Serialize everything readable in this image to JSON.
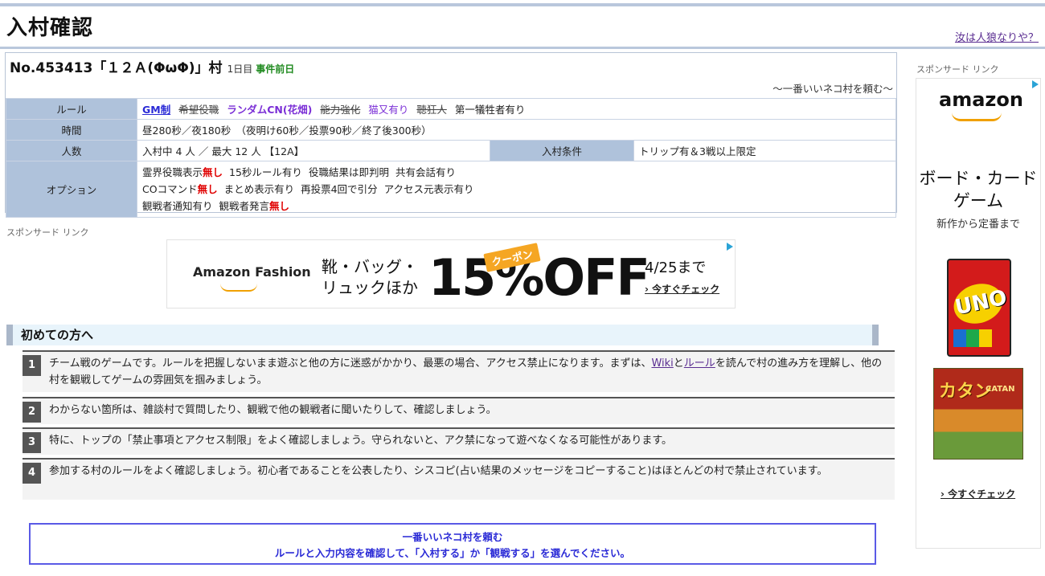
{
  "page": {
    "title": "入村確認",
    "top_link": "汝は人狼なりや？"
  },
  "village": {
    "number_title": "No.453413「１２Ａ(ΦωΦ)」村",
    "day": "1日目",
    "phase": "事件前日",
    "slogan": "～一番いいネコ村を頼む～"
  },
  "info": {
    "rule_label": "ルール",
    "rules": {
      "gm": "GM制",
      "kibou": "希望役職",
      "random": "ランダムCN(花畑)",
      "nouryoku": "能力強化",
      "nekomata": "猫又有り",
      "kyoujin": "聴狂人",
      "gisei": "第一犠牲者有り"
    },
    "time_label": "時間",
    "time_value": "昼280秒／夜180秒　（夜明け60秒／投票90秒／終了後300秒）",
    "ninzu_label": "人数",
    "ninzu_value": "入村中 4 人 ／ 最大 12 人 【12A】",
    "cond_label": "入村条件",
    "cond_value": "トリップ有＆3戦以上限定",
    "option_label": "オプション",
    "options": {
      "o1a": "霊界役職表示",
      "o1b": "無し",
      "o2": "15秒ルール有り",
      "o3": "役職結果は即判明",
      "o4": "共有会話有り",
      "o5a": "COコマンド",
      "o5b": "無し",
      "o6": "まとめ表示有り",
      "o7": "再投票4回で引分",
      "o8": "アクセス元表示有り",
      "o9": "観戦者通知有り",
      "o10a": "観戦者発言",
      "o10b": "無し"
    }
  },
  "sponsor": {
    "label": "スポンサード リンク",
    "side_label": "スポンサード リンク"
  },
  "banner_ad": {
    "brand": "Amazon Fashion",
    "goods_line1": "靴・バッグ・",
    "goods_line2": "リュックほか",
    "discount": "15%OFF",
    "coupon": "クーポン",
    "until": "4/25まで",
    "check": "› 今すぐチェック"
  },
  "first_time": {
    "title": "初めての方へ",
    "items": [
      {
        "num": "1",
        "text_a": "チーム戦のゲームです。ルールを把握しないまま遊ぶと他の方に迷惑がかかり、最悪の場合、アクセス禁止になります。まずは、",
        "link1": "Wiki",
        "mid": "と",
        "link2": "ルール",
        "text_b": "を読んで村の進み方を理解し、他の村を観戦してゲームの雰囲気を掴みましょう。"
      },
      {
        "num": "2",
        "text": "わからない箇所は、雑談村で質問したり、観戦で他の観戦者に聞いたりして、確認しましょう。"
      },
      {
        "num": "3",
        "text": "特に、トップの「禁止事項とアクセス制限」をよく確認しましょう。守られないと、アク禁になって遊べなくなる可能性があります。"
      },
      {
        "num": "4",
        "text": "参加する村のルールをよく確認しましょう。初心者であることを公表したり、シスコピ(占い結果のメッセージをコピーすること)はほとんどの村で禁止されています。"
      }
    ]
  },
  "confirm": {
    "line1": "一番いいネコ村を頼む",
    "line2": "ルールと入力内容を確認して、「入村する」か「観戦する」を選んでください。"
  },
  "side_ad": {
    "brand": "amazon",
    "heading": "ボード・カードゲーム",
    "sub": "新作から定番まで",
    "uno_word": "UNO",
    "catan_title": "カタン",
    "catan_sub": "CATAN",
    "check": "› 今すぐチェック"
  }
}
